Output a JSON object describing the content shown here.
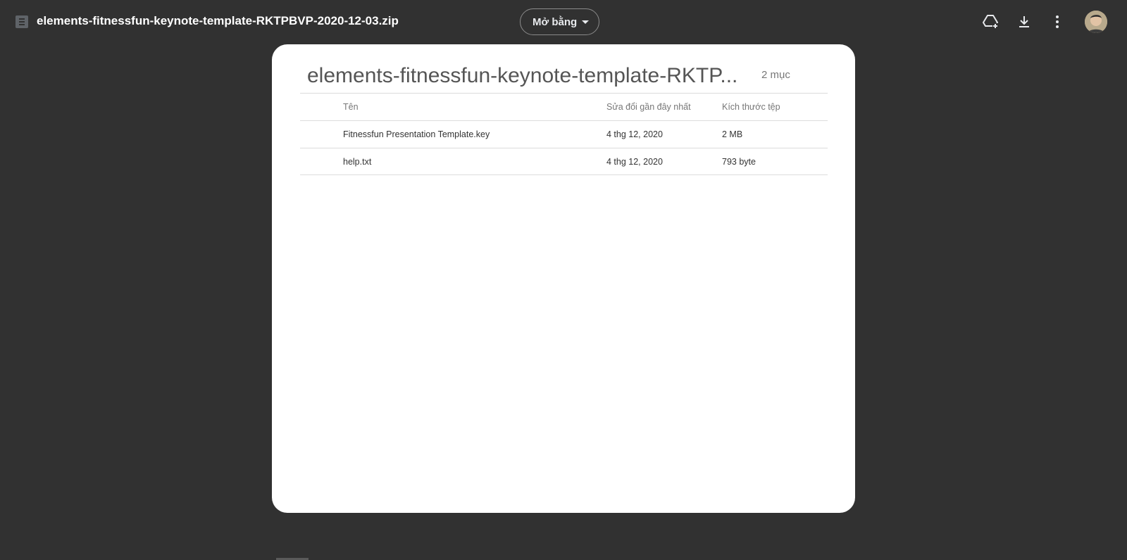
{
  "topbar": {
    "file_name": "elements-fitnessfun-keynote-template-RKTPBVP-2020-12-03.zip",
    "open_with_label": "Mở bằng",
    "icons": {
      "file_type": "zip-file-icon",
      "add_to_drive": "add-to-drive-icon",
      "download": "download-icon",
      "more": "more-vert-icon",
      "avatar": "avatar"
    }
  },
  "card": {
    "archive_name": "elements-fitnessfun-keynote-template-RKTP...",
    "item_count": "2 mục",
    "columns": {
      "name": "Tên",
      "modified": "Sửa đổi gần đây nhất",
      "size": "Kích thước tệp"
    },
    "files": [
      {
        "name": "Fitnessfun Presentation Template.key",
        "modified": "4 thg 12, 2020",
        "size": "2 MB",
        "icon": "document-icon"
      },
      {
        "name": "help.txt",
        "modified": "4 thg 12, 2020",
        "size": "793 byte",
        "icon": "document-icon"
      }
    ]
  },
  "colors": {
    "background": "#313131",
    "card": "#ffffff",
    "file_icon": "#4a86e8",
    "title_text": "#ffffff"
  }
}
